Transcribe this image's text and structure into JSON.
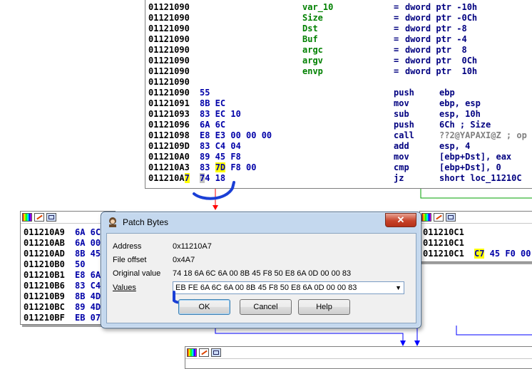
{
  "main_listing": {
    "lines": [
      {
        "addr": "01121090",
        "bytes": "",
        "label": "var_10",
        "eq": "=",
        "op": "dword ptr -10h"
      },
      {
        "addr": "01121090",
        "bytes": "",
        "label": "Size",
        "eq": "=",
        "op": "dword ptr -0Ch"
      },
      {
        "addr": "01121090",
        "bytes": "",
        "label": "Dst",
        "eq": "=",
        "op": "dword ptr -8"
      },
      {
        "addr": "01121090",
        "bytes": "",
        "label": "Buf",
        "eq": "=",
        "op": "dword ptr -4"
      },
      {
        "addr": "01121090",
        "bytes": "",
        "label": "argc",
        "eq": "=",
        "op": "dword ptr  8"
      },
      {
        "addr": "01121090",
        "bytes": "",
        "label": "argv",
        "eq": "=",
        "op": "dword ptr  0Ch"
      },
      {
        "addr": "01121090",
        "bytes": "",
        "label": "envp",
        "eq": "=",
        "op": "dword ptr  10h"
      },
      {
        "addr": "01121090",
        "bytes": "",
        "label": "",
        "eq": "",
        "op": ""
      },
      {
        "addr": "01121090",
        "bytes": "55",
        "label": "",
        "mn": "push",
        "op": "ebp"
      },
      {
        "addr": "01121091",
        "bytes": "8B EC",
        "label": "",
        "mn": "mov",
        "op": "ebp, esp"
      },
      {
        "addr": "01121093",
        "bytes": "83 EC 10",
        "label": "",
        "mn": "sub",
        "op": "esp, 10h"
      },
      {
        "addr": "01121096",
        "bytes": "6A 6C",
        "label": "",
        "mn": "push",
        "op": "6Ch ; Size"
      },
      {
        "addr": "01121098",
        "bytes": "E8 E3 00 00 00",
        "label": "",
        "mn": "call",
        "op": "??2@YAPAXI@Z ; op"
      },
      {
        "addr": "0112109D",
        "bytes": "83 C4 04",
        "label": "",
        "mn": "add",
        "op": "esp, 4"
      },
      {
        "addr": "011210A0",
        "bytes": "89 45 F8",
        "label": "",
        "mn": "mov",
        "op": "[ebp+Dst], eax"
      },
      {
        "addr": "011210A3",
        "bytes_pre": "83 ",
        "bytes_hl": "7D",
        "bytes_post": " F8 00",
        "label": "",
        "mn": "cmp",
        "op": "[ebp+Dst], 0"
      },
      {
        "addr_pre": "011210A",
        "addr_hl": "7",
        "bytes_hl2": "7",
        "bytes_rest": "4 18",
        "label": "",
        "mn": "jz",
        "op": "short loc_11210C"
      }
    ]
  },
  "left_node": {
    "lines": [
      {
        "addr": "011210A9",
        "bytes": "6A 6C"
      },
      {
        "addr": "011210AB",
        "bytes": "6A 00"
      },
      {
        "addr": "011210AD",
        "bytes": "8B 45"
      },
      {
        "addr": "011210B0",
        "bytes": "50"
      },
      {
        "addr": "011210B1",
        "bytes": "E8 6A"
      },
      {
        "addr": "011210B6",
        "bytes": "83 C4"
      },
      {
        "addr": "011210B9",
        "bytes": "8B 4D"
      },
      {
        "addr": "011210BC",
        "bytes": "89 4D"
      },
      {
        "addr": "011210BF",
        "bytes": "EB 07"
      }
    ]
  },
  "right_node": {
    "lines": [
      {
        "addr": "011210C1",
        "bytes": ""
      },
      {
        "addr": "011210C1",
        "bytes": ""
      },
      {
        "addr": "011210C1",
        "bytes_hl": "C7",
        "bytes": " 45 F0 00"
      }
    ]
  },
  "dialog": {
    "title": "Patch Bytes",
    "close_label": "✕",
    "address_label": "Address",
    "address_value": "0x11210A7",
    "offset_label": "File offset",
    "offset_value": "0x4A7",
    "original_label": "Original value",
    "original_value": "74 18 6A 6C 6A 00 8B 45 F8 50 E8 6A 0D 00 00 83",
    "values_label": "Values",
    "values_value": "EB FE 6A 6C 6A 00 8B 45 F8 50 E8 6A 0D 00 00 83",
    "ok_label": "OK",
    "cancel_label": "Cancel",
    "help_label": "Help"
  },
  "colors": {
    "edge_red": "#ff0000",
    "edge_green": "#00a000",
    "edge_blue": "#0000ff",
    "highlight": "#ffff00",
    "annotation": "#1a3fd6"
  }
}
